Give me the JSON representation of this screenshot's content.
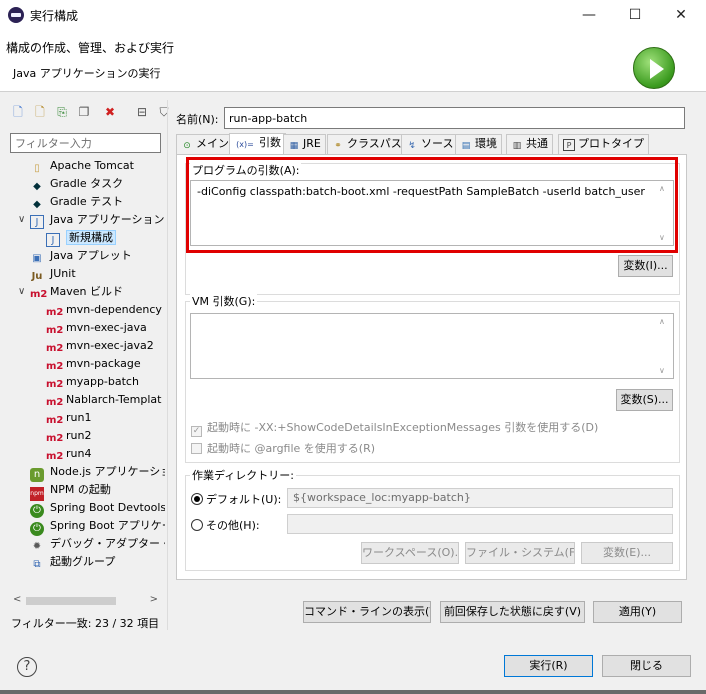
{
  "window": {
    "title": "実行構成",
    "minimize": "—",
    "maximize": "☐",
    "close": "✕"
  },
  "header": {
    "title": "構成の作成、管理、および実行",
    "subtitle": "Java アプリケーションの実行"
  },
  "left": {
    "filter_placeholder": "フィルター入力",
    "tree": [
      {
        "label": "Apache Tomcat",
        "icon": "tomcat-icon"
      },
      {
        "label": "Gradle タスク",
        "icon": "gradle-icon"
      },
      {
        "label": "Gradle テスト",
        "icon": "gradle-icon"
      },
      {
        "label": "Java アプリケーション",
        "icon": "java-app-icon",
        "expanded": true
      },
      {
        "label": "新規構成",
        "icon": "java-app-icon",
        "selected": true
      },
      {
        "label": "Java アプレット",
        "icon": "java-applet-icon"
      },
      {
        "label": "JUnit",
        "icon": "junit-icon"
      },
      {
        "label": "Maven ビルド",
        "icon": "maven-icon",
        "expanded": true
      },
      {
        "label": "mvn-dependency",
        "icon": "maven-icon"
      },
      {
        "label": "mvn-exec-java",
        "icon": "maven-icon"
      },
      {
        "label": "mvn-exec-java2",
        "icon": "maven-icon"
      },
      {
        "label": "mvn-package",
        "icon": "maven-icon"
      },
      {
        "label": "myapp-batch",
        "icon": "maven-icon"
      },
      {
        "label": "Nablarch-Templat",
        "icon": "maven-icon"
      },
      {
        "label": "run1",
        "icon": "maven-icon"
      },
      {
        "label": "run2",
        "icon": "maven-icon"
      },
      {
        "label": "run4",
        "icon": "maven-icon"
      },
      {
        "label": "Node.js アプリケーション",
        "icon": "nodejs-icon"
      },
      {
        "label": "NPM の起動",
        "icon": "npm-icon"
      },
      {
        "label": "Spring Boot Devtools",
        "icon": "spring-icon"
      },
      {
        "label": "Spring Boot アプリケーション",
        "icon": "spring-icon"
      },
      {
        "label": "デバッグ・アダプター・ランチャー",
        "icon": "debug-adapter-icon"
      },
      {
        "label": "起動グループ",
        "icon": "launch-group-icon"
      }
    ],
    "filter_status": "フィルター一致: 23 / 32 項目"
  },
  "main": {
    "name_label": "名前(N):",
    "name_value": "run-app-batch",
    "tabs": [
      {
        "label": "メイン",
        "icon": "main-tab-icon"
      },
      {
        "label": "引数",
        "icon": "arguments-tab-icon",
        "active": true
      },
      {
        "label": "JRE",
        "icon": "jre-tab-icon"
      },
      {
        "label": "クラスパス",
        "icon": "classpath-tab-icon"
      },
      {
        "label": "ソース",
        "icon": "source-tab-icon"
      },
      {
        "label": "環境",
        "icon": "environment-tab-icon"
      },
      {
        "label": "共通",
        "icon": "common-tab-icon"
      },
      {
        "label": "プロトタイプ",
        "icon": "prototype-tab-icon"
      }
    ],
    "program_args_label": "プログラムの引数(A):",
    "program_args_value": "-diConfig classpath:batch-boot.xml -requestPath SampleBatch -userId batch_user",
    "variables_button_1": "変数(I)...",
    "vm_args_label": "VM 引数(G):",
    "vm_args_value": "",
    "variables_button_2": "変数(S)...",
    "checkbox_show_code_details": "起動時に -XX:+ShowCodeDetailsInExceptionMessages 引数を使用する(D)",
    "checkbox_argfile": "起動時に @argfile を使用する(R)",
    "working_dir_label": "作業ディレクトリー:",
    "default_radio": "デフォルト(U):",
    "default_path": "${workspace_loc:myapp-batch}",
    "other_radio": "その他(H):",
    "workspace_button": "ワークスペース(O)...",
    "filesystem_button": "ファイル・システム(F)...",
    "variables_button_3": "変数(E)..."
  },
  "footer": {
    "show_command_line": "コマンド・ラインの表示(W)",
    "revert": "前回保存した状態に戻す(V)",
    "apply": "適用(Y)",
    "run": "実行(R)",
    "close": "閉じる"
  }
}
